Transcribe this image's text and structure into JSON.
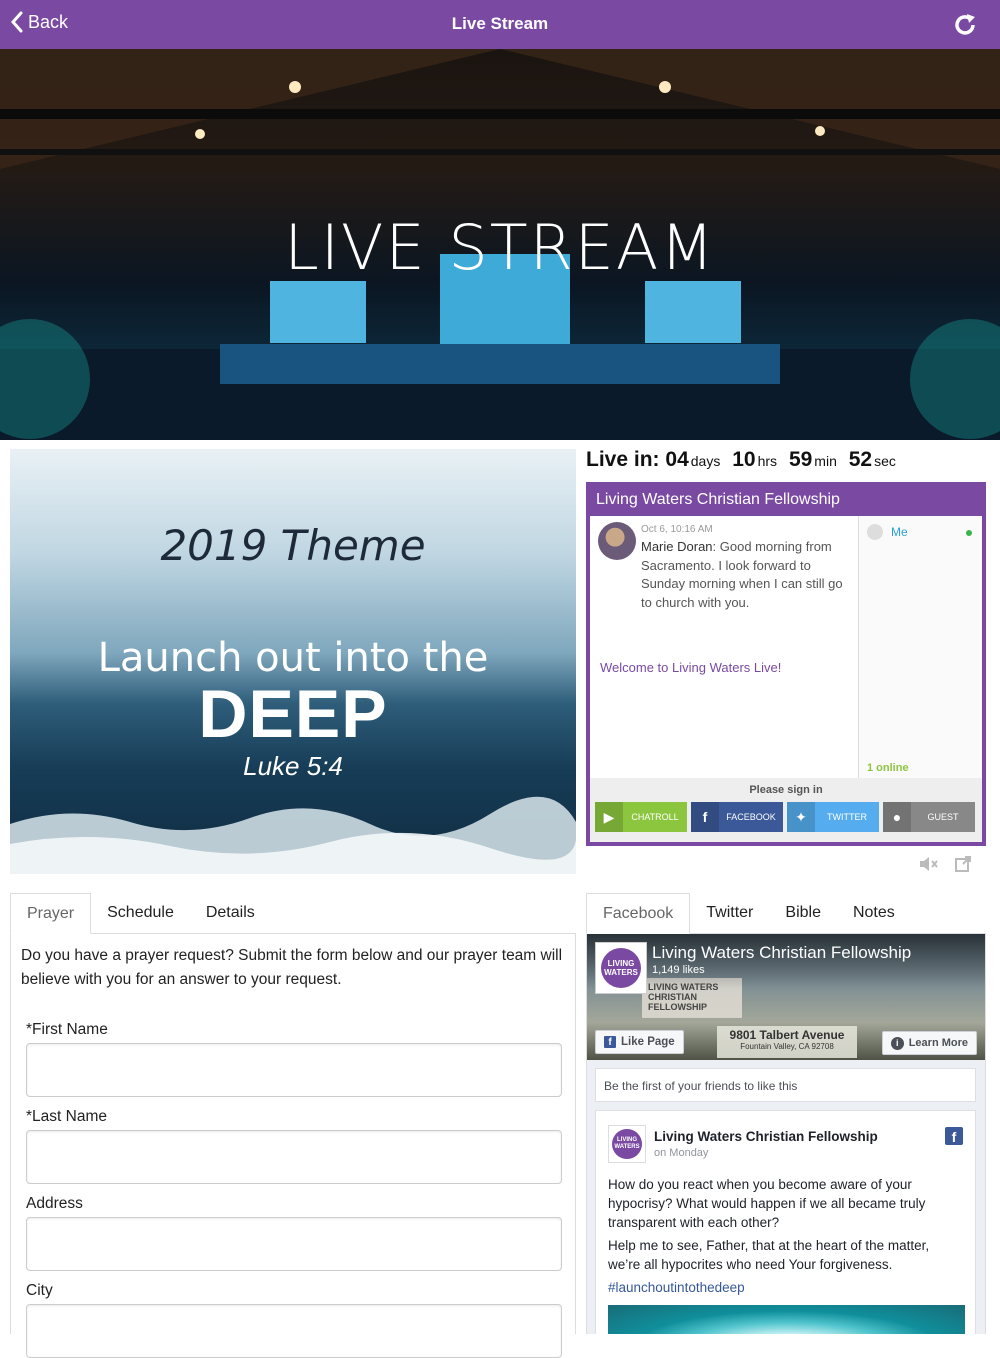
{
  "topbar": {
    "back_label": "Back",
    "title": "Live Stream",
    "refresh_icon": "refresh-icon"
  },
  "hero": {
    "title": "LIVE STREAM"
  },
  "theme_image": {
    "line1": "2019 Theme",
    "line2": "Launch out into the",
    "line3": "DEEP",
    "line4": "Luke 5:4"
  },
  "countdown": {
    "label": "Live in:",
    "days": "04",
    "days_unit": "days",
    "hrs": "10",
    "hrs_unit": "hrs",
    "min": "59",
    "min_unit": "min",
    "sec": "52",
    "sec_unit": "sec"
  },
  "chat": {
    "title": "Living Waters Christian Fellowship",
    "message": {
      "time": "Oct 6, 10:16 AM",
      "author": "Marie Doran",
      "text": ": Good morning from Sacramento. I look forward to Sunday morning when I can still go to church with you."
    },
    "welcome": "Welcome to Living Waters Live!",
    "users": {
      "me": "Me",
      "online": "1 online"
    },
    "signin": {
      "prompt": "Please sign in",
      "buttons": [
        "CHATROLL",
        "FACEBOOK",
        "TWITTER",
        "GUEST"
      ]
    },
    "status_colors": {
      "online": "#39b54a"
    }
  },
  "left_tabs": [
    "Prayer",
    "Schedule",
    "Details"
  ],
  "right_tabs": [
    "Facebook",
    "Twitter",
    "Bible",
    "Notes"
  ],
  "prayer": {
    "intro": "Do you have a prayer request? Submit the form below and our prayer team will believe with you for an answer to your request.",
    "fields": [
      {
        "label": "*First Name",
        "value": ""
      },
      {
        "label": "*Last Name",
        "value": ""
      },
      {
        "label": "Address",
        "value": ""
      },
      {
        "label": "City",
        "value": ""
      }
    ]
  },
  "facebook": {
    "page_name": "Living Waters Christian Fellowship",
    "likes": "1,149 likes",
    "sign_text": "LIVING WATERS CHRISTIAN FELLOWSHIP",
    "address1": "9801 Talbert Avenue",
    "address2": "Fountain Valley, CA 92708",
    "like_button": "Like Page",
    "learn_more": "Learn More",
    "friends_text": "Be the first of your friends to like this",
    "post": {
      "author": "Living Waters Christian Fellowship",
      "date": "on Monday",
      "para1": "How do you react when you become aware of your hypocrisy? What would happen if we all became truly transparent with each other?",
      "para2": "Help me to see, Father, that at the heart of the matter, we’re all hypocrites who need Your forgiveness.",
      "tag": "#launchoutintothedeep"
    },
    "logo_text": "LIVING WATERS"
  },
  "colors": {
    "brand_purple": "#7a4aa3",
    "facebook_blue": "#3b5998",
    "twitter_blue": "#55acee",
    "chatroll_green": "#8cc63f"
  }
}
